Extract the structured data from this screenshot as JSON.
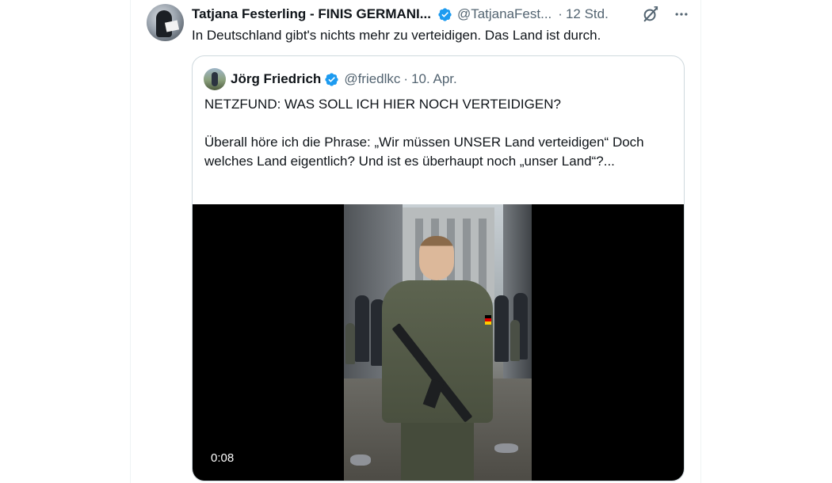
{
  "tweet": {
    "display_name": "Tatjana Festerling - FINIS GERMANI...",
    "handle": "@TatjanaFest...",
    "separator": "·",
    "time": "12 Std.",
    "text": "In Deutschland gibt's nichts mehr zu verteidigen. Das Land ist durch."
  },
  "quote": {
    "display_name": "Jörg Friedrich",
    "handle": "@friedlkc",
    "separator": "·",
    "time": "10. Apr.",
    "paragraphs": [
      "NETZFUND: WAS SOLL ICH HIER NOCH VERTEIDIGEN?",
      "Überall höre ich die Phrase: „Wir müssen UNSER Land verteidigen“ Doch welches Land eigentlich? Und ist es überhaupt noch „unser Land“?..."
    ],
    "video_duration": "0:08"
  },
  "colors": {
    "text": "#0f1419",
    "secondary": "#536471",
    "verified": "#1d9bf0",
    "border": "#cfd9de"
  },
  "icons": [
    "verified-badge-icon",
    "grok-icon",
    "more-icon"
  ]
}
